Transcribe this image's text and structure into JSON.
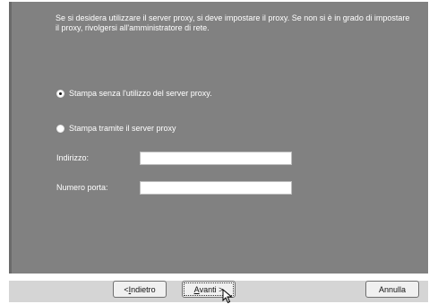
{
  "intro_text": "Se si desidera utilizzare il server proxy, si deve impostare il proxy. Se non si è in grado di impostare il proxy, rivolgersi all'amministratore di rete.",
  "options": {
    "no_proxy": "Stampa senza l'utilizzo del server proxy.",
    "use_proxy": "Stampa tramite il server proxy"
  },
  "fields": {
    "address_label": "Indirizzo:",
    "address_value": "",
    "port_label": "Numero porta:",
    "port_value": ""
  },
  "buttons": {
    "back_prefix": "< ",
    "back_mnemonic": "I",
    "back_rest": "ndietro",
    "next_mnemonic": "A",
    "next_rest": "vanti >",
    "cancel": "Annulla"
  },
  "colors": {
    "panel": "#818181",
    "footer_band": "#d5d5d5"
  }
}
